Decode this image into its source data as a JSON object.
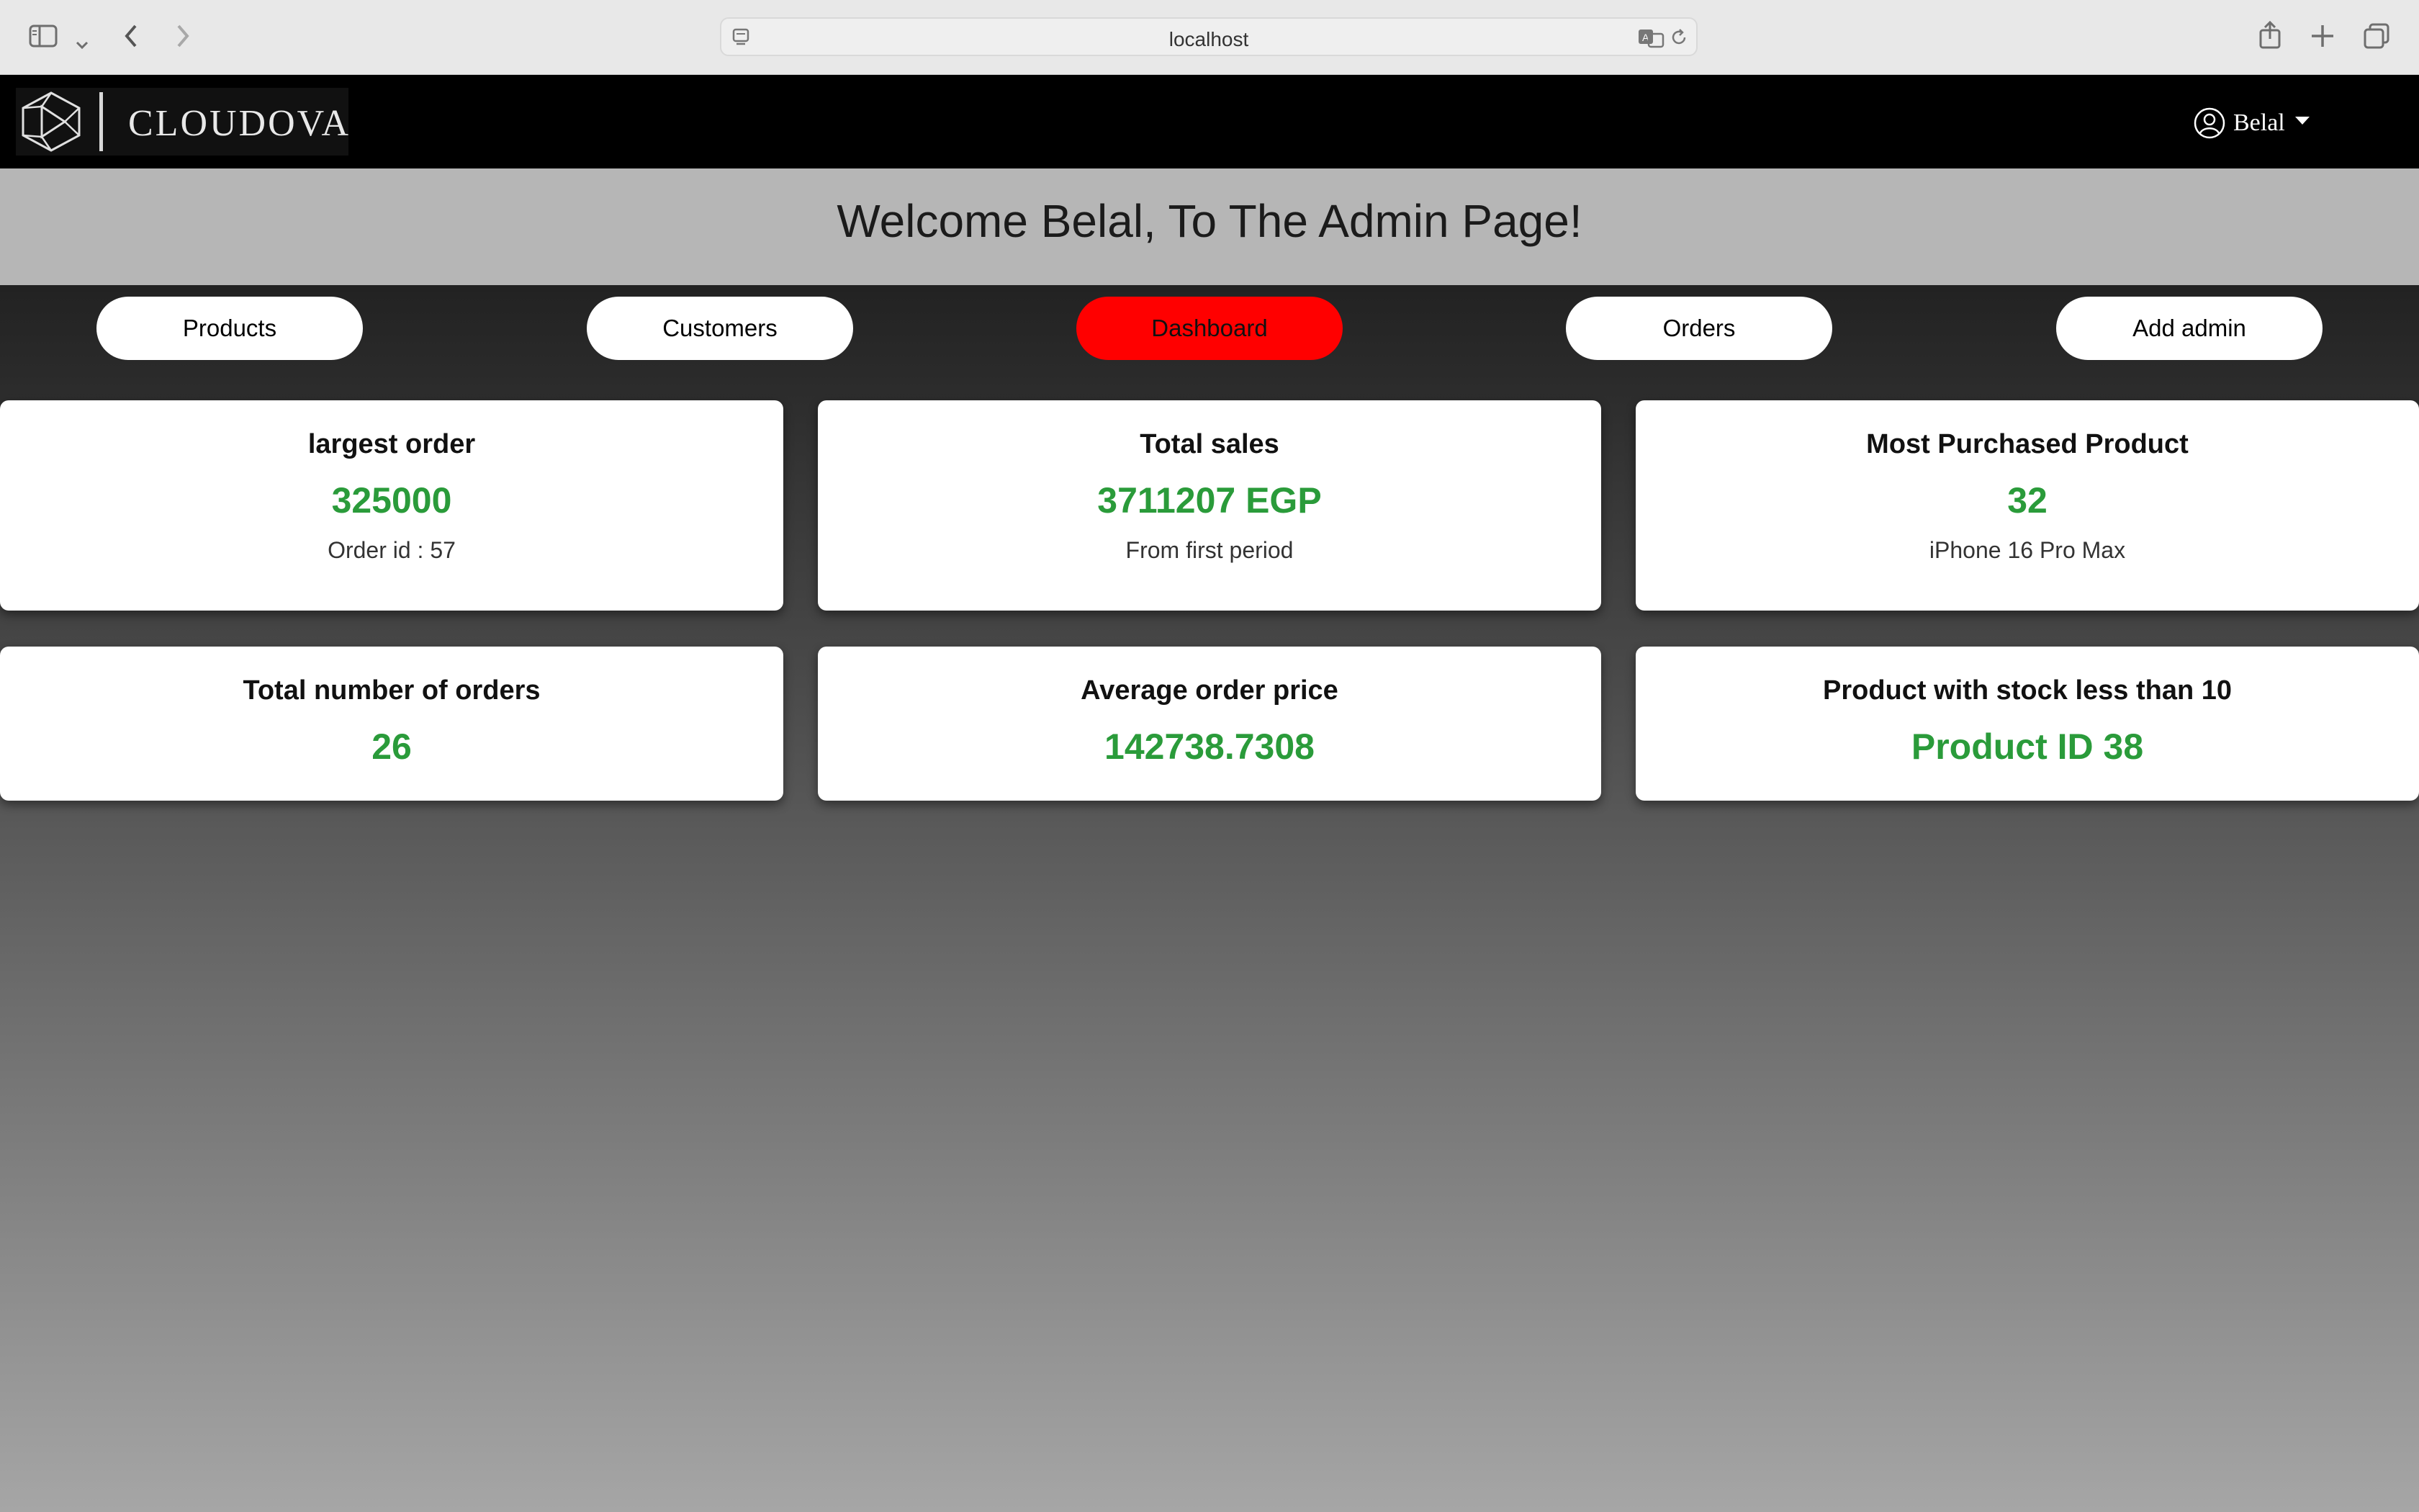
{
  "browser": {
    "url": "localhost",
    "icons": [
      "sidebar-icon",
      "chevron-down-icon",
      "back-icon",
      "forward-icon",
      "site-settings-icon",
      "translate-icon",
      "reload-icon",
      "share-icon",
      "new-tab-icon",
      "tabs-overview-icon"
    ]
  },
  "header": {
    "brand": "CLOUDOVA",
    "user_name": "Belal",
    "icons": [
      "logo-polyhedron-icon",
      "user-circle-icon",
      "caret-down-icon"
    ]
  },
  "welcome": {
    "title": "Welcome Belal, To The Admin Page!"
  },
  "nav": {
    "products": "Products",
    "customers": "Customers",
    "dashboard": "Dashboard",
    "orders": "Orders",
    "add_admin": "Add admin",
    "active": "Dashboard",
    "active_color": "#ff0000"
  },
  "cards": {
    "largest_order": {
      "title": "largest order",
      "value": "325000",
      "sub": "Order id : 57"
    },
    "total_sales": {
      "title": "Total sales",
      "value": "3711207 EGP",
      "sub": "From first period"
    },
    "most_purchased": {
      "title": "Most Purchased Product",
      "value": "32",
      "sub": "iPhone 16 Pro Max"
    },
    "total_orders": {
      "title": "Total number of orders",
      "value": "26"
    },
    "average_price": {
      "title": "Average order price",
      "value": "142738.7308"
    },
    "low_stock": {
      "title": "Product with stock less than 10",
      "value": "Product ID 38"
    }
  },
  "colors": {
    "value_green": "#2a9b3a",
    "header_bg": "#000000",
    "band_bg": "#b6b6b6"
  }
}
